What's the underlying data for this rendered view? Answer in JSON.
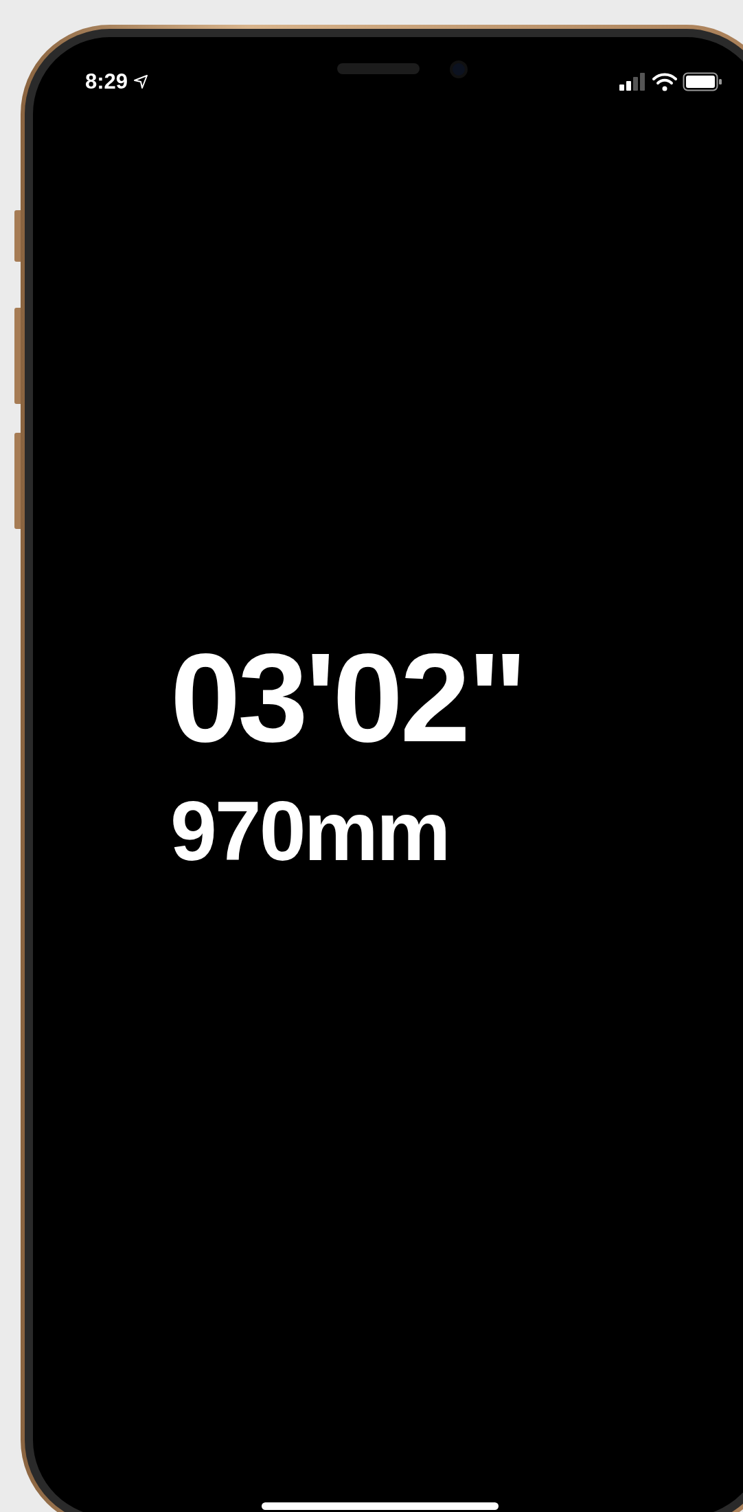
{
  "status_bar": {
    "time": "8:29"
  },
  "timer": {
    "elapsed": "03'02\"",
    "distance": "970mm"
  }
}
